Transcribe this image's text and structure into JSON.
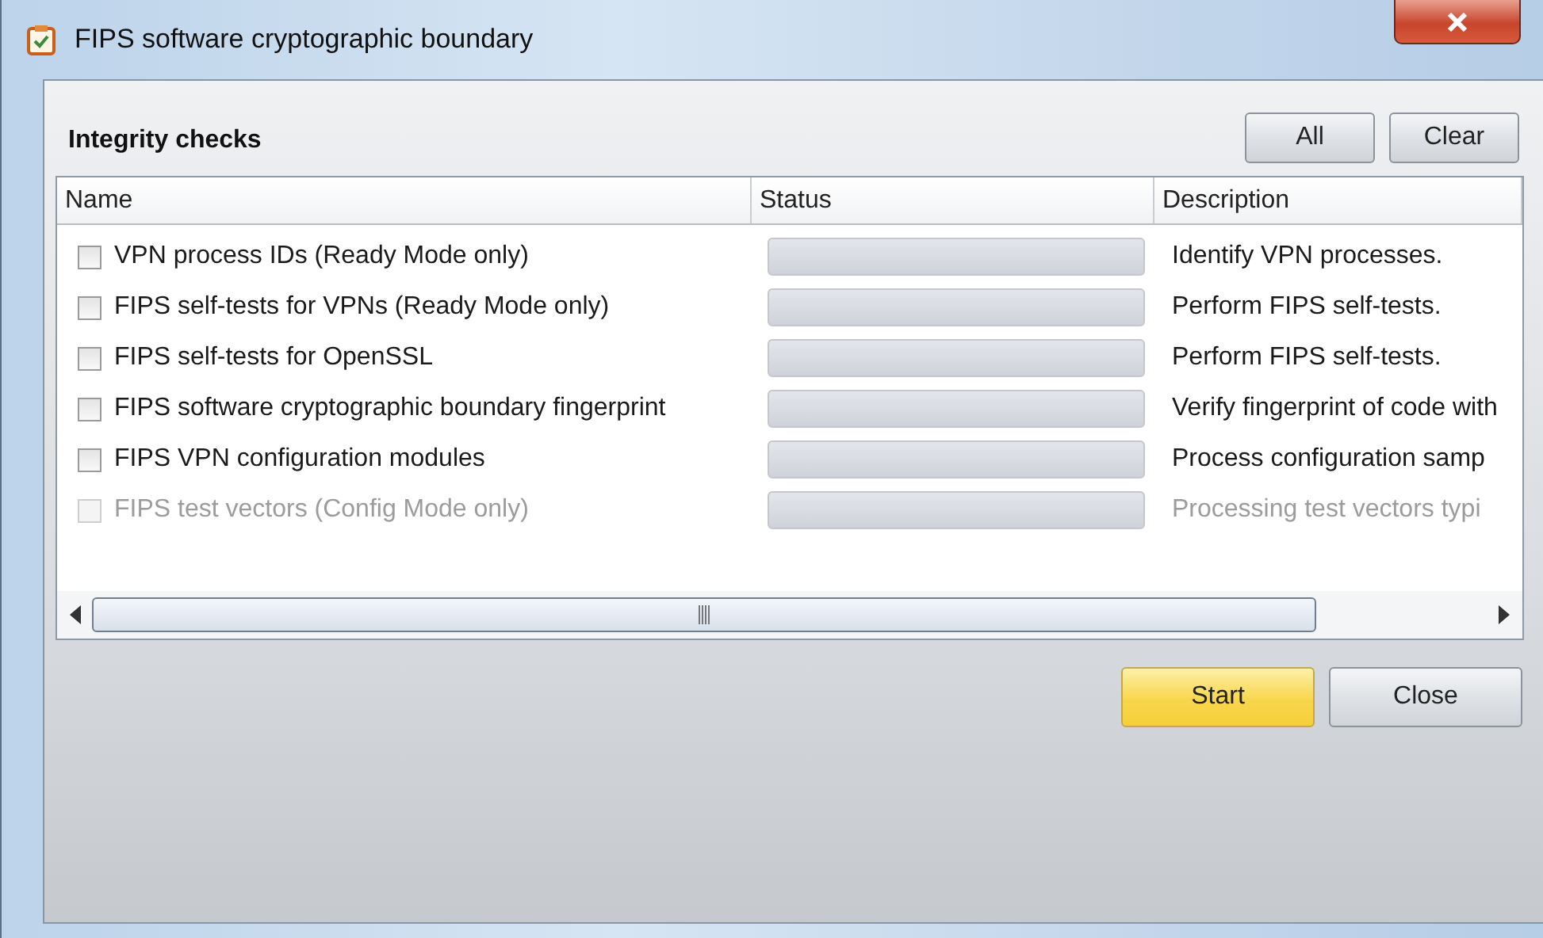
{
  "window": {
    "title": "FIPS software cryptographic boundary"
  },
  "section": {
    "title": "Integrity checks"
  },
  "header_buttons": [
    "All",
    "Clear"
  ],
  "table": {
    "columns": [
      "Name",
      "Status",
      "Description"
    ],
    "rows": [
      {
        "name": "VPN process IDs (Ready Mode only)",
        "checked": false,
        "disabled": false,
        "level": 0,
        "description": "Identify VPN processes."
      },
      {
        "name": "FIPS self-tests for VPNs (Ready Mode only)",
        "checked": false,
        "disabled": false,
        "level": 0,
        "description": "Perform FIPS self-tests."
      },
      {
        "name": "FIPS self-tests for OpenSSL",
        "checked": false,
        "disabled": false,
        "level": 0,
        "description": "Perform FIPS self-tests."
      },
      {
        "name": "FIPS software cryptographic boundary fingerprint",
        "checked": false,
        "disabled": false,
        "level": 0,
        "description": "Verify fingerprint of code with"
      },
      {
        "name": "FIPS VPN configuration modules",
        "checked": false,
        "disabled": false,
        "level": 0,
        "description": "Process configuration samp"
      },
      {
        "name": "FIPS test vectors (Config Mode only)",
        "checked": false,
        "disabled": true,
        "level": 0,
        "description": "Processing test vectors typi"
      }
    ]
  },
  "footer_buttons": [
    {
      "label": "Start",
      "default": true
    },
    {
      "label": "Close",
      "default": false
    }
  ]
}
